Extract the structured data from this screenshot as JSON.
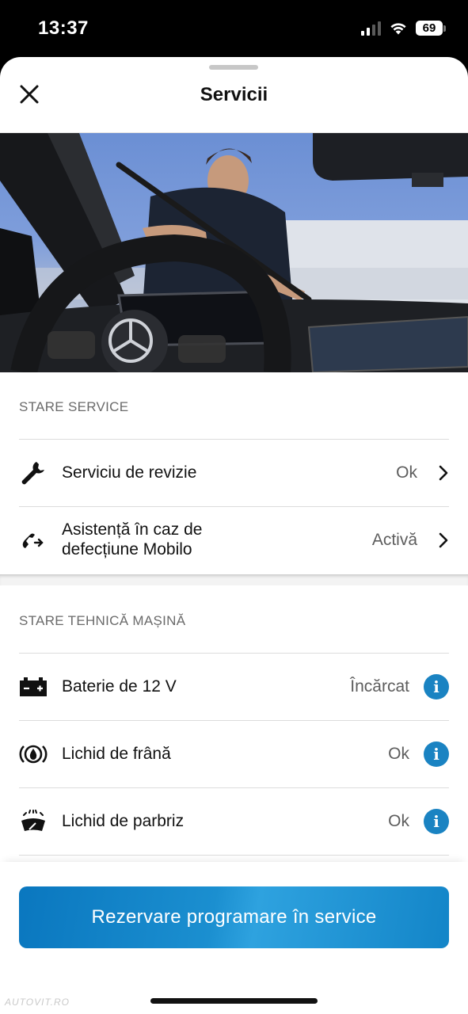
{
  "status_bar": {
    "time": "13:37",
    "battery": "69"
  },
  "header": {
    "title": "Servicii",
    "close_icon": "close-icon"
  },
  "stare_service": {
    "label": "STARE SERVICE",
    "items": [
      {
        "label": "Serviciu de revizie",
        "value": "Ok",
        "icon": "wrench-icon"
      },
      {
        "label": "Asistență în caz de\ndefecțiune Mobilo",
        "value": "Activă",
        "icon": "phone-assist-icon"
      }
    ]
  },
  "stare_tehnica": {
    "label": "STARE TEHNICĂ MAȘINĂ",
    "items": [
      {
        "label": "Baterie de 12 V",
        "value": "Încărcat",
        "icon": "battery-icon"
      },
      {
        "label": "Lichid de frână",
        "value": "Ok",
        "icon": "brake-fluid-icon"
      },
      {
        "label": "Lichid de parbriz",
        "value": "Ok",
        "icon": "washer-fluid-icon"
      }
    ]
  },
  "cta": {
    "label": "Rezervare programare în service"
  },
  "watermark": "AUTOVIT.RO",
  "colors": {
    "accent": "#1a83c2",
    "cta": "#0a77bf"
  }
}
